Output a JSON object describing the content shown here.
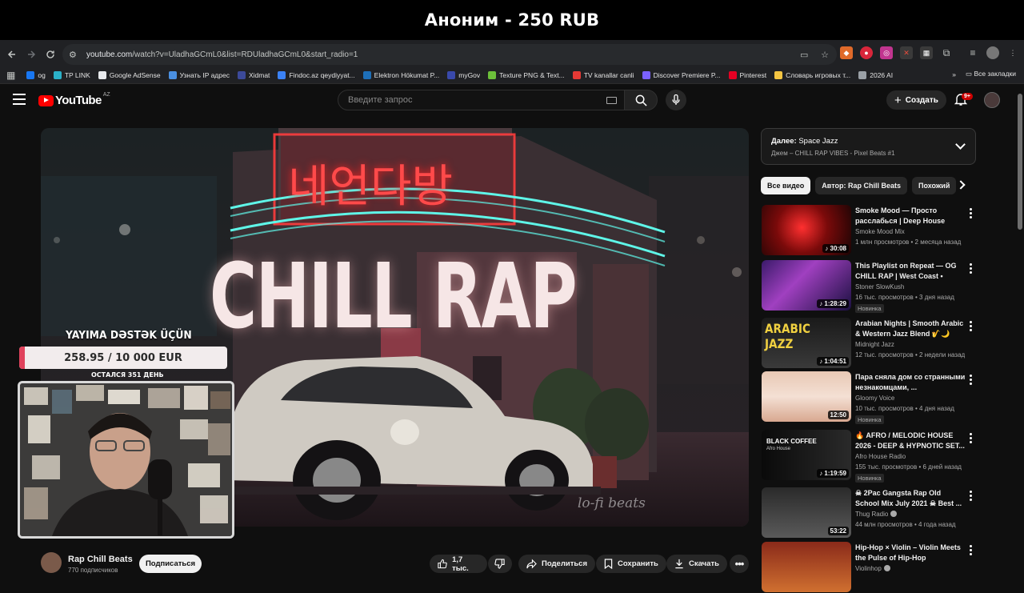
{
  "banner": {
    "text": "Аноним - 250 RUB"
  },
  "browser": {
    "url_host": "youtube.com",
    "url_path": "/watch?v=UladhaGCmL0&list=RDUladhaGCmL0&start_radio=1",
    "bookmarks": [
      {
        "label": "og",
        "color": "#1877f2"
      },
      {
        "label": "TP LINK",
        "color": "#2bb1c8"
      },
      {
        "label": "Google AdSense",
        "color": "#e8eaed"
      },
      {
        "label": "Узнать IP адрес",
        "color": "#4a90e2"
      },
      {
        "label": "Xidmat",
        "color": "#3c4a9a"
      },
      {
        "label": "Findoc.az qeydiyyat...",
        "color": "#3b82f6"
      },
      {
        "label": "Elektron Hökumat P...",
        "color": "#1e6fb8"
      },
      {
        "label": "myGov",
        "color": "#3949ab"
      },
      {
        "label": "Texture PNG & Text...",
        "color": "#6cbf3a"
      },
      {
        "label": "TV kanallar canli",
        "color": "#e53935"
      },
      {
        "label": "Discover Premiere P...",
        "color": "#7b61ff"
      },
      {
        "label": "Pinterest",
        "color": "#e60023"
      },
      {
        "label": "Словарь игровых т...",
        "color": "#f4c542"
      },
      {
        "label": "2026 AI",
        "color": "#9aa0a6"
      }
    ],
    "all_bookmarks": "Все закладки"
  },
  "youtube": {
    "logo_text": "YouTube",
    "region": "AZ",
    "search_placeholder": "Введите запрос",
    "create_label": "Создать",
    "notif_count": "9+"
  },
  "video": {
    "neon_sign": "네언다방",
    "title_overlay": "CHILL RAP",
    "watermark": "lo-fi beats"
  },
  "stream_overlay": {
    "goal_title": "YAYIMA DƏSTƏK ÜÇÜN",
    "goal_text": "258.95 / 10 000 EUR",
    "goal_fraction": 0.026,
    "days_left": "ОСТАЛСЯ 351 ДЕНЬ"
  },
  "channel": {
    "name": "Rap Chill Beats",
    "subscribers": "770 подписчиков",
    "subscribe_label": "Подписаться"
  },
  "actions": {
    "likes": "1,7 тыс.",
    "share": "Поделиться",
    "save": "Сохранить",
    "download": "Скачать"
  },
  "upnext": {
    "label": "Далее:",
    "title": "Space Jazz",
    "subtitle": "Джем – CHILL RAP VIBES - Pixel Beats #1"
  },
  "chips": [
    "Все видео",
    "Автор: Rap Chill Beats",
    "Похожий"
  ],
  "recommendations": [
    {
      "title": "Smoke Mood — Просто расслабься | Deep House мик...",
      "channel": "Smoke Mood Mix",
      "meta": "1 млн просмотров • 2 месяца назад",
      "duration": "30:08",
      "badge": "",
      "verified": false
    },
    {
      "title": "This Playlist on Repeat — OG CHILL RAP | West Coast • Chill...",
      "channel": "Stoner SlowKush",
      "meta": "16 тыс. просмотров • 3 дня назад",
      "duration": "1:28:29",
      "badge": "Новинка",
      "verified": false
    },
    {
      "title": "Arabian Nights | Smooth Arabic & Western Jazz Blend 🎷🌙",
      "channel": "Midnight Jazz",
      "meta": "12 тыс. просмотров • 2 недели назад",
      "duration": "1:04:51",
      "badge": "",
      "verified": false
    },
    {
      "title": "Пара сняла дом со странными незнакомцами, ...",
      "channel": "Gloomy Voice",
      "meta": "10 тыс. просмотров • 4 дня назад",
      "duration": "12:50",
      "badge": "Новинка",
      "verified": false
    },
    {
      "title": "🔥 AFRO / MELODIC HOUSE 2026 - DEEP & HYPNOTIC SET...",
      "channel": "Afro House Radio",
      "meta": "155 тыс. просмотров • 6 дней назад",
      "duration": "1:19:59",
      "badge": "Новинка",
      "verified": false
    },
    {
      "title": "☠ 2Pac Gangsta Rap Old School Mix July 2021 ☠ Best ...",
      "channel": "Thug Radio",
      "meta": "44 млн просмотров • 4 года назад",
      "duration": "53:22",
      "badge": "",
      "verified": true
    },
    {
      "title": "Hip-Hop × Violin – Violin Meets the Pulse of Hip-Hop",
      "channel": "Violinhop",
      "meta": "",
      "duration": "",
      "badge": "",
      "verified": true
    }
  ],
  "thumb_texts": {
    "arabic": "ARABIC JAZZ",
    "black_coffee": "BLACK COFFEE",
    "afro": "Afro House"
  }
}
